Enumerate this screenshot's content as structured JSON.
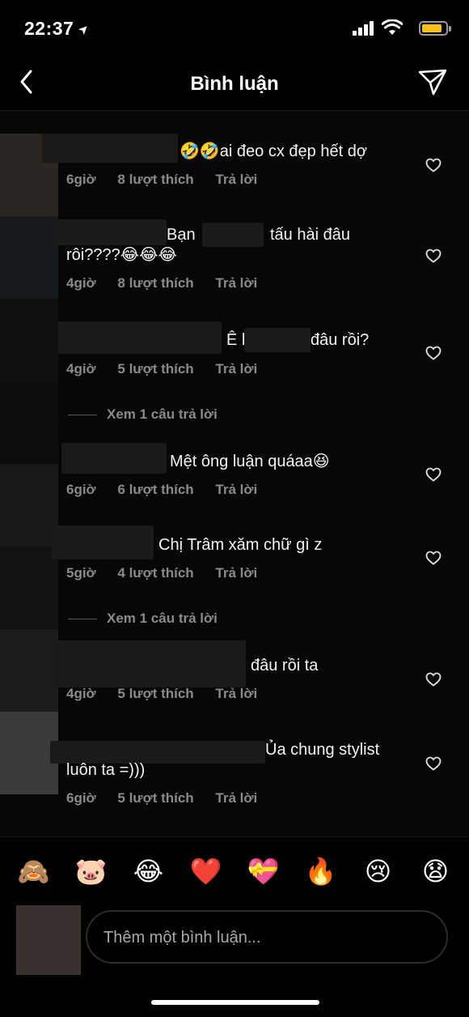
{
  "status_bar": {
    "time": "22:37"
  },
  "header": {
    "title": "Bình luận"
  },
  "comments": [
    {
      "text": "🤣🤣ai đeo cx đẹp hết dợ",
      "time": "6giờ",
      "likes": "8 lượt thích",
      "reply": "Trả lời"
    },
    {
      "text_line1": "Bạn",
      "text_line1b": "tấu hài đâu",
      "text_line2": "rôi????😂😂😂",
      "time": "4giờ",
      "likes": "8 lượt thích",
      "reply": "Trả lời"
    },
    {
      "text_a": "Ê b",
      "text_b": "đâu rồi?",
      "time": "4giờ",
      "likes": "5 lượt thích",
      "reply": "Trả lời",
      "view_replies": "Xem 1 câu trả lời"
    },
    {
      "text": "Mệt ông luận quáaa😆",
      "time": "6giờ",
      "likes": "6 lượt thích",
      "reply": "Trả lời"
    },
    {
      "text": "Chị Trâm xăm chữ gì z",
      "time": "5giờ",
      "likes": "4 lượt thích",
      "reply": "Trả lời",
      "view_replies": "Xem 1 câu trả lời"
    },
    {
      "text": "đâu rồi ta",
      "time": "4giờ",
      "likes": "5 lượt thích",
      "reply": "Trả lời"
    },
    {
      "text_line1": "Ủa chung stylist",
      "text_line2": "luôn ta =)))",
      "time": "6giờ",
      "likes": "5 lượt thích",
      "reply": "Trả lời"
    }
  ],
  "emoji_bar": [
    "🙈",
    "🐷",
    "😂",
    "❤️",
    "💝",
    "🔥",
    "😢",
    "😧"
  ],
  "input": {
    "placeholder": "Thêm một bình luận..."
  },
  "icons": {
    "back": "chevron-left-icon",
    "send": "paper-plane-icon",
    "like": "heart-outline-icon"
  },
  "colors": {
    "background": "#000000",
    "meta_text": "#8a8a8a",
    "battery": "#f4c020"
  }
}
